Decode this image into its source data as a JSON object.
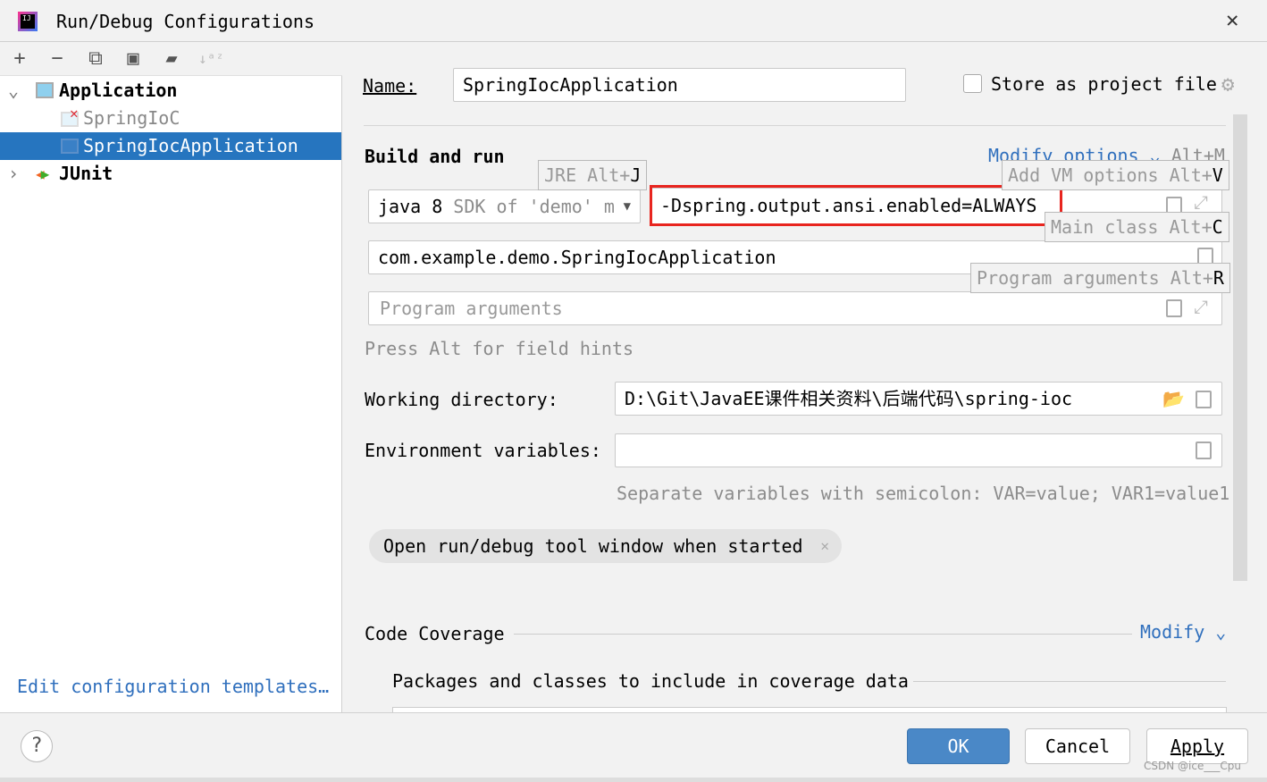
{
  "window": {
    "title": "Run/Debug Configurations"
  },
  "toolbar": {
    "icons": [
      "add-icon",
      "remove-icon",
      "copy-icon",
      "save-icon",
      "new-folder-icon",
      "sort-az-icon"
    ]
  },
  "tree": {
    "items": [
      {
        "label": "Application",
        "expanded": true
      },
      {
        "label": "SpringIoC",
        "error": true
      },
      {
        "label": "SpringIocApplication",
        "selected": true
      },
      {
        "label": "JUnit",
        "expanded": false
      }
    ]
  },
  "left_footer": {
    "edit_templates": "Edit configuration templates…"
  },
  "form": {
    "name_label": "Name:",
    "name_value": "SpringIocApplication",
    "store_label": "Store as project file",
    "store_checked": false,
    "build_run": "Build and run",
    "modify_options": "Modify options",
    "modify_shortcut": "Alt+M",
    "jre_value": "java 8",
    "jre_hint": "SDK of 'demo' m",
    "vm_options": "-Dspring.output.ansi.enabled=ALWAYS",
    "main_class": "com.example.demo.SpringIocApplication",
    "program_args_placeholder": "Program arguments",
    "press_alt": "Press Alt for field hints",
    "workdir_label": "Working directory:",
    "workdir_value": "D:\\Git\\JavaEE课件相关资料\\后端代码\\spring-ioc",
    "env_label": "Environment variables:",
    "env_value": "",
    "env_hint": "Separate variables with semicolon: VAR=value; VAR1=value1",
    "chip": "Open run/debug tool window when started",
    "coverage": "Code Coverage",
    "coverage_modify": "Modify",
    "packages": "Packages and classes to include in coverage data"
  },
  "hints": {
    "jre": {
      "text": "JRE Alt+",
      "key": "J"
    },
    "vm": {
      "text": "Add VM options Alt+",
      "key": "V"
    },
    "main": {
      "text": "Main class Alt+",
      "key": "C"
    },
    "args": {
      "text": "Program arguments Alt+",
      "key": "R"
    }
  },
  "buttons": {
    "ok": "OK",
    "cancel": "Cancel",
    "apply": "Apply",
    "help": "?"
  },
  "watermark": "CSDN @ice___Cpu",
  "colors": {
    "selection": "#2675bf",
    "ok": "#4a88c7",
    "highlight": "#e8251f",
    "link": "#2f6fbd"
  }
}
